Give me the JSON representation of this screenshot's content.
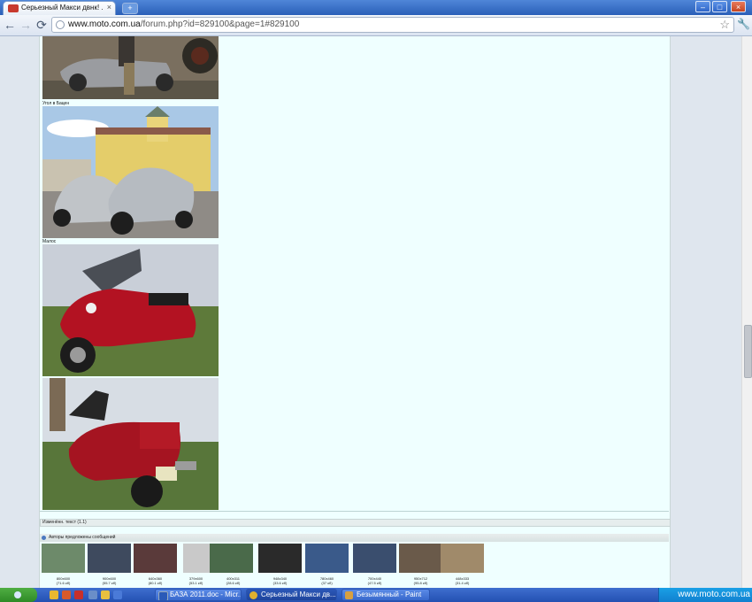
{
  "browser": {
    "tab_title": "Серьезный Макси двнк! ...",
    "tab_close": "×",
    "new_tab": "+",
    "url_host": "www.moto.com.ua",
    "url_path": "/forum.php?id=829100&page=1#829100",
    "back_icon": "←",
    "forward_icon": "→",
    "reload_icon": "⟳",
    "star_icon": "☆",
    "wrench_icon": "🔧"
  },
  "window_controls": {
    "minimize": "–",
    "maximize": "□",
    "close": "×"
  },
  "post": {
    "captions": [
      "Угол в Бацен",
      "Малос"
    ],
    "edited_text": "Изменённ. текст (1.1)",
    "similar_header": "Авторы предложены сообщений"
  },
  "thumbnails": [
    {
      "size": "800x600",
      "weight": "(71.6 кб)"
    },
    {
      "size": "900x600",
      "weight": "(55.7 кб)"
    },
    {
      "size": "640x360",
      "weight": "(80.1 кб)"
    },
    {
      "size": "379x600",
      "weight": "(53.1 кб)"
    },
    {
      "size": "400x311",
      "weight": "(28.6 кб)"
    },
    {
      "size": "948x340",
      "weight": "(33.6 кб)"
    },
    {
      "size": "780x460",
      "weight": "(37 кб)"
    },
    {
      "size": "700x440",
      "weight": "(47.5 кб)"
    },
    {
      "size": "950x712",
      "weight": "(95.8 кб)"
    },
    {
      "size": "448x333",
      "weight": "(31.4 кб)"
    }
  ],
  "taskbar": {
    "tasks": [
      "БАЗА 2011.doc - Micr...",
      "Серьезный Макси дв...",
      "Безымянный - Paint"
    ],
    "tray_text": "www.moto.com.ua"
  }
}
